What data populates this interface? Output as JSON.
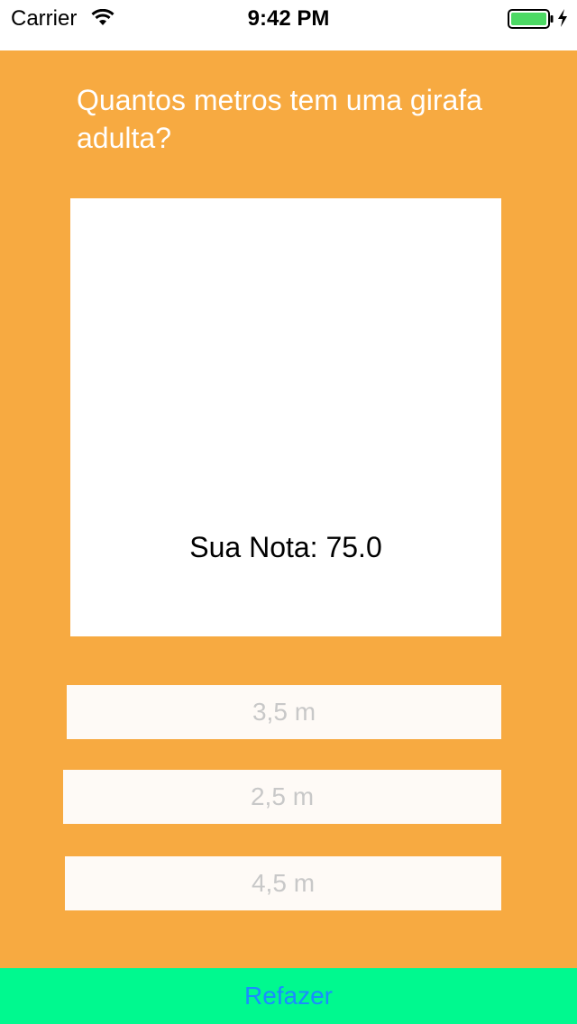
{
  "status_bar": {
    "carrier": "Carrier",
    "time": "9:42 PM",
    "wifi_icon": "wifi-icon",
    "battery_icon": "battery-icon",
    "charging_icon": "charging-bolt-icon",
    "battery_color": "#4cd964"
  },
  "quiz": {
    "question": "Quantos metros tem uma girafa adulta?",
    "score_text": "Sua Nota: 75.0",
    "answers": [
      {
        "label": "3,5 m"
      },
      {
        "label": "2,5 m"
      },
      {
        "label": "4,5 m"
      }
    ],
    "redo_label": "Refazer"
  },
  "colors": {
    "background": "#f7aa41",
    "redo_background": "#00f98f",
    "redo_text": "#1a8cff",
    "answer_background": "#fefaf6",
    "answer_text": "#c8c8c8"
  }
}
